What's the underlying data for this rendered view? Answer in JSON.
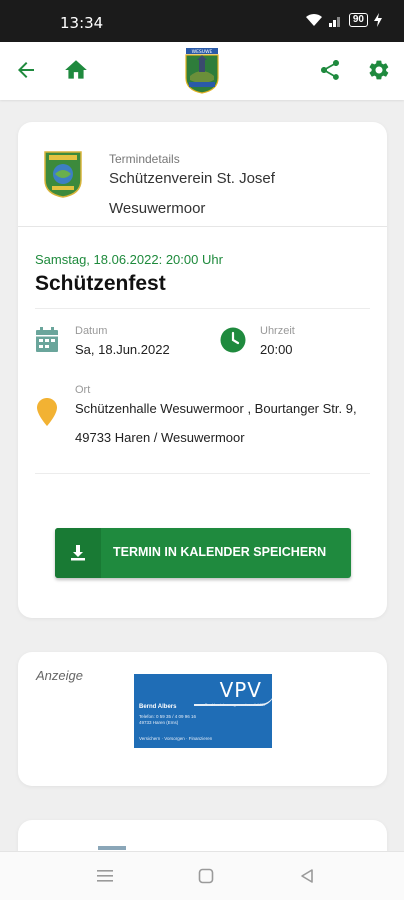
{
  "status_bar": {
    "time": "13:34",
    "battery": "90",
    "icons": [
      "wifi-icon",
      "signal-icon",
      "battery-icon",
      "charging-icon"
    ]
  },
  "app_bar": {
    "icons": [
      "back-arrow-icon",
      "home-icon",
      "club-logo",
      "share-icon",
      "settings-icon"
    ],
    "logo_text": "WESUWE"
  },
  "details": {
    "section_label": "Termindetails",
    "club_name": "Schützenverein St. Josef",
    "club_place": "Wesuwermoor",
    "date_time": "Samstag, 18.06.2022: 20:00 Uhr",
    "title": "Schützenfest",
    "date_label": "Datum",
    "date_value": "Sa, 18.Jun.2022",
    "time_label": "Uhrzeit",
    "time_value": "20:00",
    "location_label": "Ort",
    "location_line1": "Schützenhalle Wesuwermoor , Bourtanger Str. 9,",
    "location_line2": "49733 Haren / Wesuwermoor",
    "save_button": "TERMIN IN KALENDER SPEICHERN"
  },
  "ad": {
    "label": "Anzeige",
    "brand": "VPV",
    "tagline": "Der Versicherungsverein seit 1827",
    "person": "Bernd Albers",
    "contact": [
      "Telefon: 0 59 35 / 4 09 96 16",
      "49733 Haren (Ems)"
    ],
    "footer": "Versichern · Vorsorgen · Finanzieren"
  },
  "colors": {
    "accent": "#1f8a3e",
    "date_text": "#1e8a3c",
    "calendar_icon": "#6aa59b",
    "pin_icon": "#f2b233",
    "ad_blue": "#1f6db6"
  },
  "nav_bar": {
    "icons": [
      "menu-icon",
      "home-square-icon",
      "back-triangle-icon"
    ]
  }
}
